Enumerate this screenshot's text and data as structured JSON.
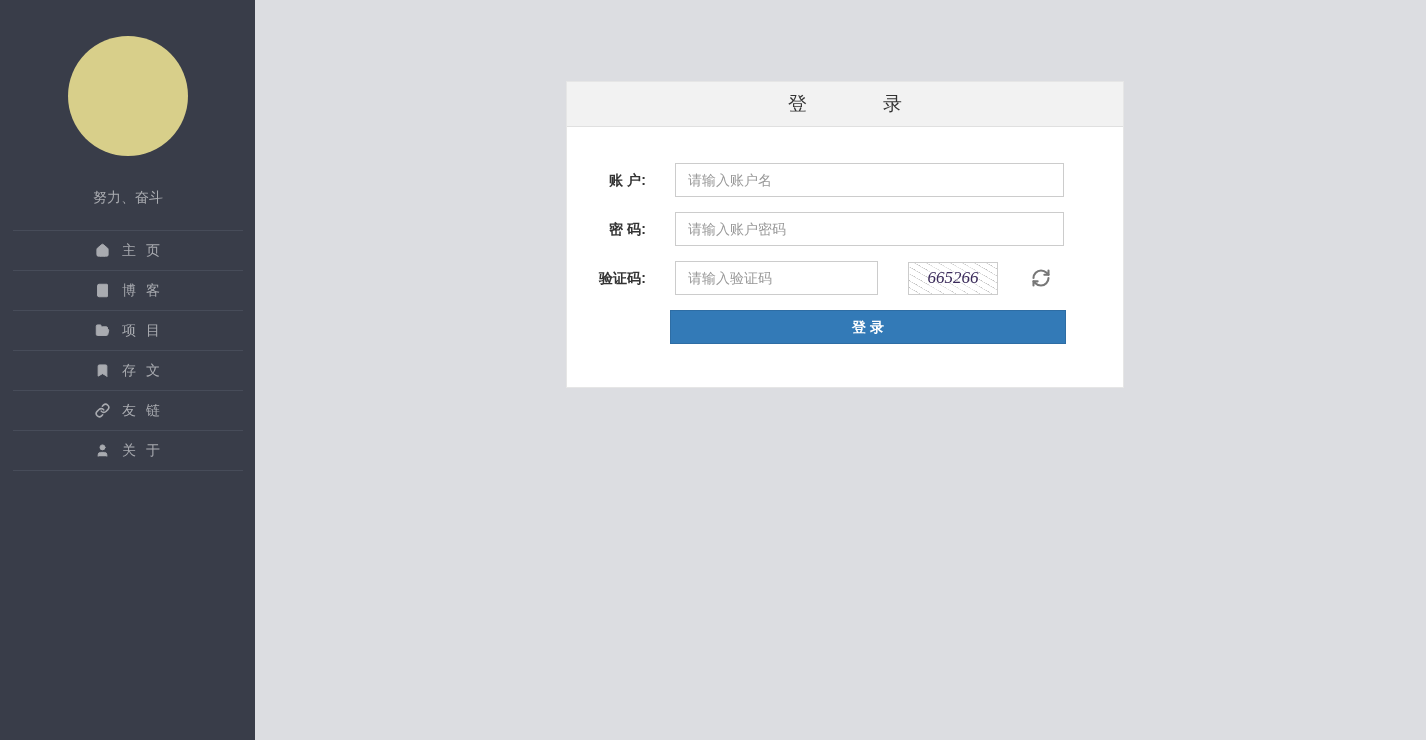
{
  "sidebar": {
    "motto": "努力、奋斗",
    "items": [
      {
        "kind": "home",
        "label": "主 页"
      },
      {
        "kind": "book",
        "label": "博 客"
      },
      {
        "kind": "folder",
        "label": "项 目"
      },
      {
        "kind": "bookmark",
        "label": "存 文"
      },
      {
        "kind": "link",
        "label": "友 链"
      },
      {
        "kind": "user",
        "label": "关 于"
      }
    ]
  },
  "login": {
    "title": "登 录",
    "fields": [
      {
        "label": "账 户:",
        "placeholder": "请输入账户名",
        "kind": "text"
      },
      {
        "label": "密 码:",
        "placeholder": "请输入账户密码",
        "kind": "password"
      },
      {
        "label": "验证码:",
        "placeholder": "请输入验证码",
        "kind": "captcha",
        "captcha": "665266"
      }
    ],
    "button": "登 录"
  }
}
